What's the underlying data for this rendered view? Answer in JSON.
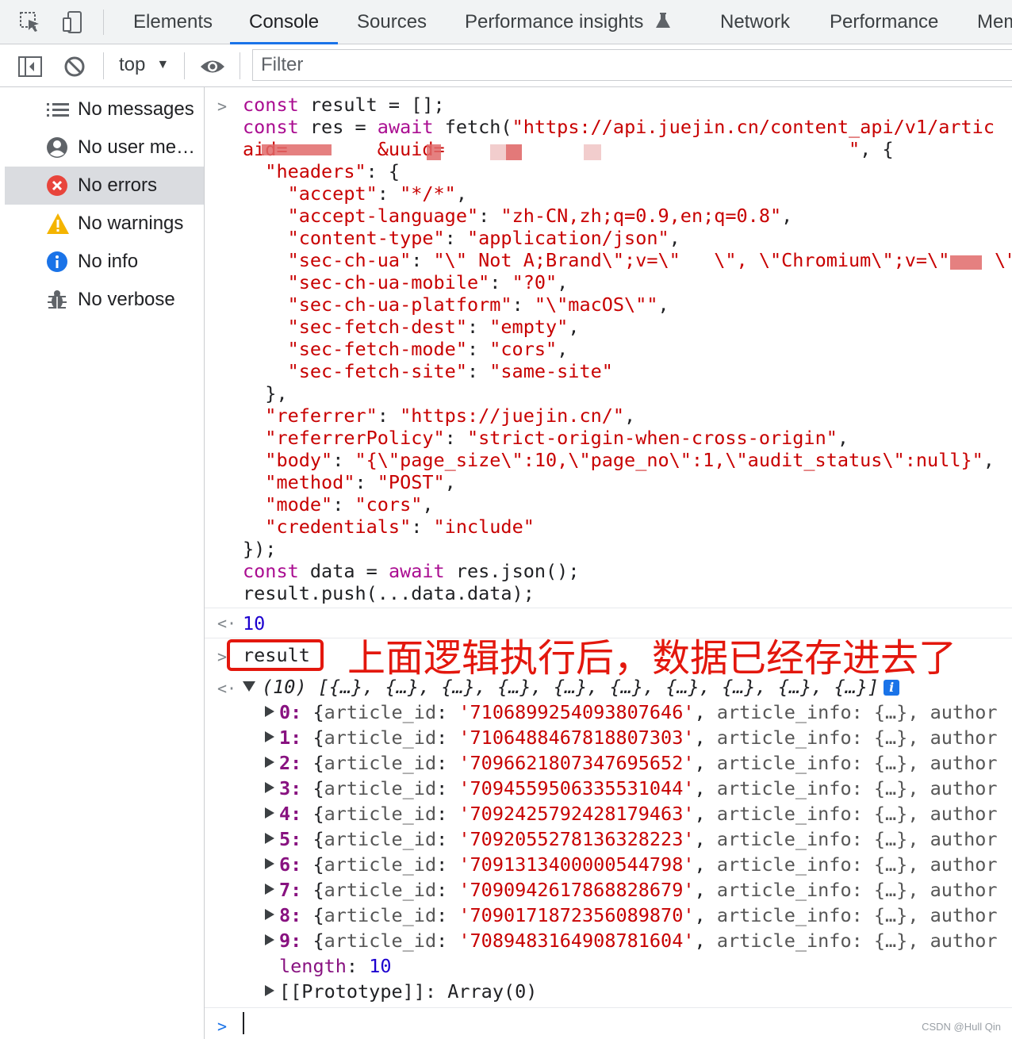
{
  "tabs": [
    "Elements",
    "Console",
    "Sources",
    "Performance insights",
    "Network",
    "Performance",
    "Mem"
  ],
  "toolbar": {
    "context": "top",
    "filter_placeholder": "Filter"
  },
  "sidebar": {
    "items": [
      {
        "label": "No messages",
        "icon": "list-icon"
      },
      {
        "label": "No user me…",
        "icon": "user-icon"
      },
      {
        "label": "No errors",
        "icon": "error-icon"
      },
      {
        "label": "No warnings",
        "icon": "warning-icon"
      },
      {
        "label": "No info",
        "icon": "info-icon"
      },
      {
        "label": "No verbose",
        "icon": "bug-icon"
      }
    ]
  },
  "console": {
    "input_lines": [
      "const result = [];",
      "const res = await fetch(\"https://api.juejin.cn/content_api/v1/artic",
      "aid=        &uuid=                                    \", {",
      "  \"headers\": {",
      "    \"accept\": \"*/*\",",
      "    \"accept-language\": \"zh-CN,zh;q=0.9,en;q=0.8\",",
      "    \"content-type\": \"application/json\",",
      "    \"sec-ch-ua\": \"\\\" Not A;Brand\\\";v=\\\"   \\\", \\\"Chromium\\\";v=\\\"    \\\"",
      "    \"sec-ch-ua-mobile\": \"?0\",",
      "    \"sec-ch-ua-platform\": \"\\\"macOS\\\"\",",
      "    \"sec-fetch-dest\": \"empty\",",
      "    \"sec-fetch-mode\": \"cors\",",
      "    \"sec-fetch-site\": \"same-site\"",
      "  },",
      "  \"referrer\": \"https://juejin.cn/\",",
      "  \"referrerPolicy\": \"strict-origin-when-cross-origin\",",
      "  \"body\": \"{\\\"page_size\\\":10,\\\"page_no\\\":1,\\\"audit_status\\\":null}\",",
      "  \"method\": \"POST\",",
      "  \"mode\": \"cors\",",
      "  \"credentials\": \"include\"",
      "});",
      "const data = await res.json();",
      "result.push(...data.data);"
    ],
    "output_1": "10",
    "input_2": "result",
    "annotation": "上面逻辑执行后，数据已经存进去了",
    "array_summary": "(10) [{…}, {…}, {…}, {…}, {…}, {…}, {…}, {…}, {…}, {…}]",
    "rows": [
      {
        "index": "0",
        "article_id": "'7106899254093807646'"
      },
      {
        "index": "1",
        "article_id": "'7106488467818807303'"
      },
      {
        "index": "2",
        "article_id": "'7096621807347695652'"
      },
      {
        "index": "3",
        "article_id": "'7094559506335531044'"
      },
      {
        "index": "4",
        "article_id": "'7092425792428179463'"
      },
      {
        "index": "5",
        "article_id": "'7092055278136328223'"
      },
      {
        "index": "6",
        "article_id": "'7091313400000544798'"
      },
      {
        "index": "7",
        "article_id": "'7090942617868828679'"
      },
      {
        "index": "8",
        "article_id": "'7090171872356089870'"
      },
      {
        "index": "9",
        "article_id": "'7089483164908781604'"
      }
    ],
    "row_key": "article_id",
    "row_tail": "article_info: {…}, author",
    "length_label": "length",
    "length_value": "10",
    "prototype": "[[Prototype]]: Array(0)"
  },
  "watermark": "CSDN @Hull Qin"
}
